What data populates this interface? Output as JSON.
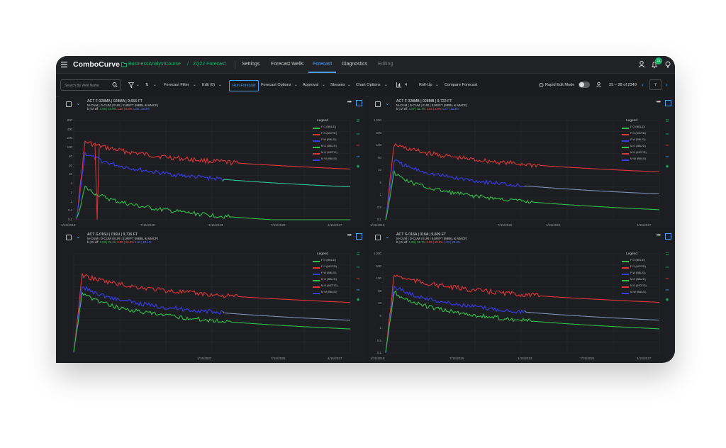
{
  "app": {
    "title": "ComboCurve",
    "project": "BusinessAnalystCourse",
    "separator": "/",
    "scenario": "2Q22 Forecast",
    "tabs": [
      {
        "label": "Settings",
        "active": false
      },
      {
        "label": "Forecast Wells",
        "active": false
      },
      {
        "label": "Forecast",
        "active": true
      },
      {
        "label": "Diagnostics",
        "active": false
      },
      {
        "label": "Editing",
        "active": false
      }
    ],
    "notification_count": "21"
  },
  "toolbar": {
    "search_placeholder": "Search By Well Name",
    "forecast_filter": "Forecast Filter",
    "edit": "Edit (0)",
    "run_forecast": "Run Forecast",
    "forecast_options": "Forecast Options",
    "approval": "Approval",
    "streams": "Streams",
    "chart_options": "Chart Options",
    "chart_count": "4",
    "roll_up": "Roll-Up",
    "compare": "Compare Forecast",
    "rapid_edit": "Rapid Edit Mode",
    "range": "25 – 28 of 2349",
    "page": "7"
  },
  "legend_title": "Legend",
  "panels": [
    {
      "title": "ACT F 028MA | 028MA | 9,656 FT",
      "meta": "M-CUM | D-CUM | EUR | EUR/FT (MBBL & MMCF)",
      "desc_label": "b | Di eff:",
      "desc_g": "1.06 | 23.9%",
      "desc_r": "1.30 | 9.0%",
      "desc_b": "1.06 | 26.4%",
      "legend": [
        "F O (BBL/D)",
        "F G (MCF/D)",
        "F W (BBL/D)",
        "M O (BBL/D)",
        "M G (MCF/D)",
        "M W (BBL/D)"
      ],
      "y_ticks": [
        "800",
        "400",
        "200",
        "100",
        "40",
        "20",
        "10",
        "4",
        "2",
        "1",
        "0.4",
        "0.2"
      ],
      "x_ticks": [
        "1/15/2018",
        "7/15/2020",
        "1/15/2023",
        "7/15/2025",
        "4/15/2027"
      ]
    },
    {
      "title": "ACT F 028MB | 028MB | 9,722 FT",
      "meta": "M-CUM | D-CUM | EUR | EUR/FT (MBBL & MMCF)",
      "desc_label": "b | Di eff:",
      "desc_g": "1.07 | 51.7%",
      "desc_r": "1.03 | 3.8%",
      "desc_b": "1.07 | 42.3%",
      "legend": [
        "F O (BBL/D)",
        "F G (MCF/D)",
        "F W (BBL/D)",
        "M O (BBL/D)",
        "M G (MCF/D)",
        "M W (BBL/D)"
      ],
      "y_ticks": [
        "1,000",
        "500",
        "100",
        "50",
        "10",
        "5",
        "1",
        "0.5",
        "0.1"
      ],
      "x_ticks": [
        "1/15/2018",
        "7/15/2026",
        "1/15/2023",
        "4/15/2027"
      ]
    },
    {
      "title": "ACT G 016U | 016U | 9,716 FT",
      "meta": "M-CUM | D-CUM | EUR | EUR/FT (MBBL & MMCF)",
      "desc_label": "b | Di eff:",
      "desc_g": "1.03 | 21.1%",
      "desc_r": "1.30 | 26.3%",
      "desc_b": "1.03 | 22.1%",
      "legend": [
        "F O (BBL/D)",
        "F G (MCF/D)",
        "F W (BBL/D)",
        "M O (BBL/D)",
        "M G (MCF/D)",
        "M W (BBL/D)"
      ],
      "y_ticks": [],
      "x_ticks": [
        "1/15/2023",
        "7/15/2025",
        "4/15/2027"
      ]
    },
    {
      "title": "ACT G 016A | 016A | 9,609 FT",
      "meta": "M-CUM | D-CUM | EUR | EUR/FT (MBBL & MMCF)",
      "desc_label": "b | Di eff:",
      "desc_g": "1.03 | 51.7%",
      "desc_r": "1.03 | 33.9%",
      "desc_b": "1.03 | 29.6%",
      "legend": [
        "F O (BBL/D)",
        "F G (MCF/D)",
        "F W (BBL/D)",
        "M O (BBL/D)",
        "M G (MCF/D)",
        "M W (BBL/D)"
      ],
      "y_ticks": [
        "1,000",
        "500",
        "100",
        "50",
        "10",
        "5",
        "1",
        "0.5",
        "0.1"
      ],
      "x_ticks": [
        "1/15/2018",
        "7/15/2026",
        "1/15/2023",
        "7/15/2025",
        "4/15/2027"
      ]
    }
  ],
  "colors": {
    "oil": "#2fbf4a",
    "gas": "#e0353a",
    "water": "#3a3cf0",
    "forecast_oil": "#2ec49a",
    "forecast_water": "#7b8fb5"
  }
}
